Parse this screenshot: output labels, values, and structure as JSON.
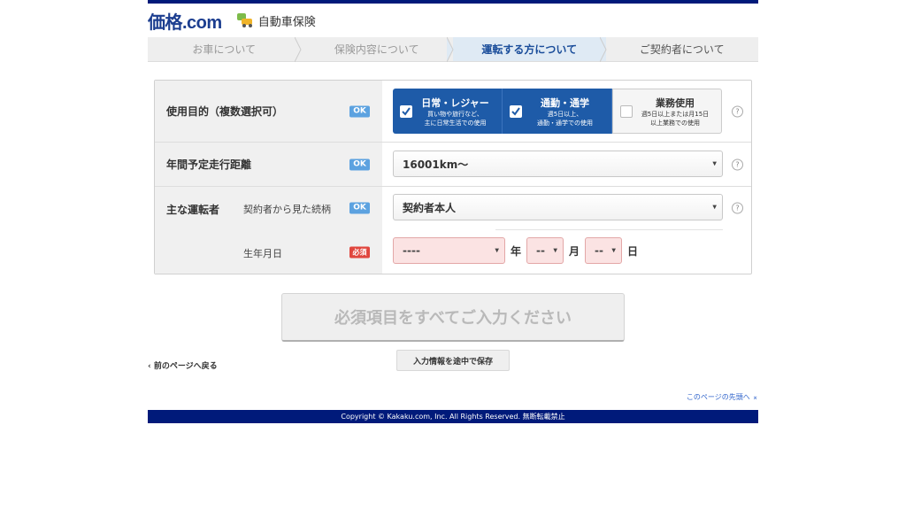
{
  "header": {
    "logo": "価格.com",
    "service": "自動車保険"
  },
  "steps": [
    {
      "label": "お車について"
    },
    {
      "label": "保険内容について"
    },
    {
      "label": "運転する方について"
    },
    {
      "label": "ご契約者について"
    }
  ],
  "form": {
    "purpose": {
      "label": "使用目的（複数選択可）",
      "status": "OK",
      "options": [
        {
          "main": "日常・レジャー",
          "sub1": "買い物や旅行など、",
          "sub2": "主に日常生活での使用",
          "checked": true
        },
        {
          "main": "通勤・通学",
          "sub1": "週5日以上、",
          "sub2": "通勤・通学での使用",
          "checked": true
        },
        {
          "main": "業務使用",
          "sub1": "週5日以上または月15日",
          "sub2": "以上業務での使用",
          "checked": false
        }
      ]
    },
    "mileage": {
      "label": "年間予定走行距離",
      "status": "OK",
      "value": "16001km〜"
    },
    "driver": {
      "label": "主な運転者",
      "relation_label": "契約者から見た続柄",
      "relation_status": "OK",
      "relation_value": "契約者本人",
      "dob_label": "生年月日",
      "dob_status": "必須",
      "year_value": "----",
      "year_unit": "年",
      "month_value": "--",
      "month_unit": "月",
      "day_value": "--",
      "day_unit": "日"
    },
    "help": "?"
  },
  "submit_label": "必須項目をすべてご入力ください",
  "save_label": "入力情報を途中で保存",
  "back_label": "前のページへ戻る",
  "totop_label": "このページの先頭へ",
  "footer": "Copyright © Kakaku.com, Inc. All Rights Reserved. 無断転載禁止",
  "colors": {
    "brand_navy": "#001a7a",
    "selected_blue": "#1e5ba8",
    "ok_badge": "#5ca2e0",
    "required_badge": "#e0463e"
  }
}
